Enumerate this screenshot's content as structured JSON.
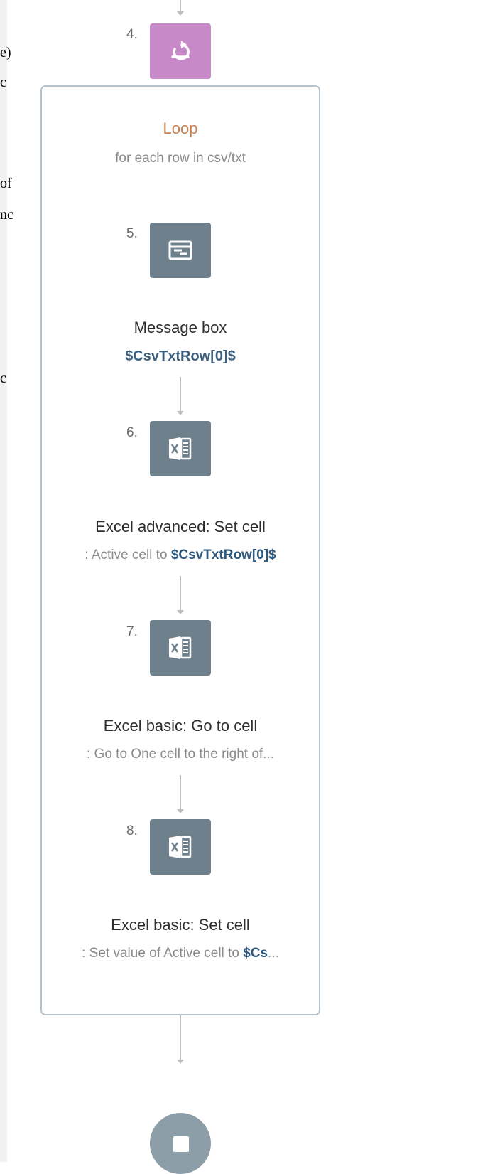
{
  "left_fragments": [
    "e)",
    "c",
    "of",
    "nc",
    "c"
  ],
  "steps": [
    {
      "number": "4.",
      "title": "Loop",
      "subtitle": "for each row in csv/txt",
      "icon": "loop-icon"
    },
    {
      "number": "5.",
      "title": "Message box",
      "subtitle": "$CsvTxtRow[0]$",
      "icon": "message-box-icon"
    },
    {
      "number": "6.",
      "title": "Excel advanced: Set cell",
      "subtitle_prefix": ": Active cell to ",
      "subtitle_var": "$CsvTxtRow[0]$",
      "icon": "excel-icon"
    },
    {
      "number": "7.",
      "title": "Excel basic: Go to cell",
      "subtitle": ": Go to One cell to the right of...",
      "icon": "excel-icon"
    },
    {
      "number": "8.",
      "title": "Excel basic: Set cell",
      "subtitle_prefix": ": Set value of Active cell to ",
      "subtitle_var": "$Cs",
      "subtitle_suffix": "...",
      "icon": "excel-icon"
    }
  ],
  "end_node": {
    "icon": "stop-icon"
  },
  "colors": {
    "loop_tile": "#c889c8",
    "action_tile": "#6e808c",
    "loop_title": "#c9804e",
    "variable": "#2f5a7f",
    "connector": "#bdbdbd",
    "loop_border": "#b7c4ce"
  }
}
